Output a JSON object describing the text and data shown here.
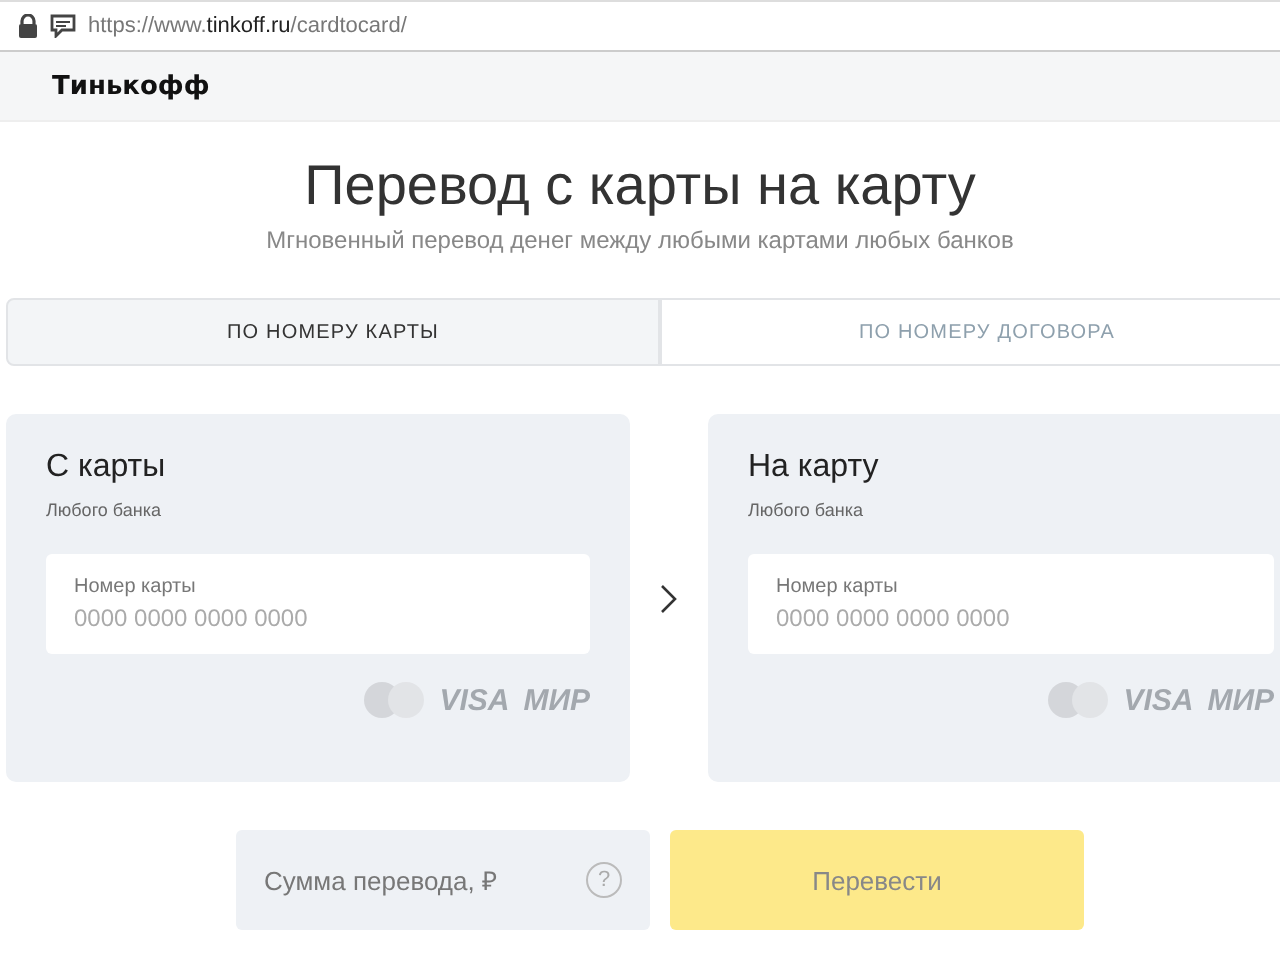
{
  "browser": {
    "url_prefix": "https://www.",
    "url_domain": "tinkoff.ru",
    "url_path": "/cardtocard/"
  },
  "header": {
    "brand": "Тинькофф"
  },
  "page": {
    "title": "Перевод с карты на карту",
    "subtitle": "Мгновенный перевод денег между любыми картами любых банков"
  },
  "tabs": [
    {
      "label": "ПО НОМЕРУ КАРТЫ",
      "selected": true
    },
    {
      "label": "ПО НОМЕРУ ДОГОВОРА",
      "selected": false
    }
  ],
  "cards": [
    {
      "title": "С карты",
      "subtitle": "Любого банка",
      "field_label": "Номер карты",
      "placeholder": "0000 0000 0000 0000",
      "logos": [
        "VISA",
        "МИР"
      ]
    },
    {
      "title": "На карту",
      "subtitle": "Любого банка",
      "field_label": "Номер карты",
      "placeholder": "0000 0000 0000 0000",
      "logos": [
        "VISA",
        "МИР"
      ]
    }
  ],
  "amount": {
    "placeholder": "Сумма перевода, ₽",
    "help": "?"
  },
  "submit": {
    "label": "Перевести",
    "disabled": true
  }
}
